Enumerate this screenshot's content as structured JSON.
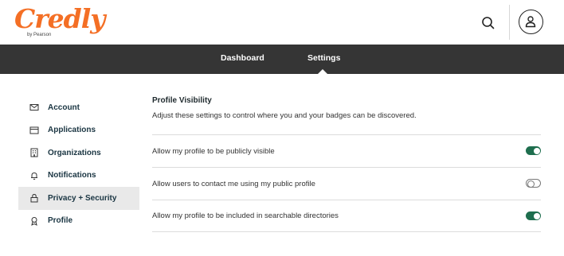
{
  "brand": {
    "name": "Credly",
    "sub": "by Pearson",
    "color": "#f46f25"
  },
  "header": {
    "search_icon": "search-icon",
    "avatar_icon": "user-icon"
  },
  "nav": {
    "tabs": [
      {
        "label": "Dashboard",
        "active": false
      },
      {
        "label": "Settings",
        "active": true
      }
    ],
    "background": "#353535"
  },
  "sidebar": {
    "items": [
      {
        "label": "Account",
        "icon": "mail-icon",
        "active": false
      },
      {
        "label": "Applications",
        "icon": "browser-window-icon",
        "active": false
      },
      {
        "label": "Organizations",
        "icon": "building-icon",
        "active": false
      },
      {
        "label": "Notifications",
        "icon": "bell-icon",
        "active": false
      },
      {
        "label": "Privacy + Security",
        "icon": "lock-icon",
        "active": true
      },
      {
        "label": "Profile",
        "icon": "badge-icon",
        "active": false
      }
    ]
  },
  "main": {
    "title": "Profile Visibility",
    "description": "Adjust these settings to control where you and your badges can be discovered.",
    "settings": [
      {
        "label": "Allow my profile to be publicly visible",
        "enabled": true
      },
      {
        "label": "Allow users to contact me using my public profile",
        "enabled": false
      },
      {
        "label": "Allow my profile to be included in searchable directories",
        "enabled": true
      }
    ],
    "toggle_on_color": "#1e6e4e"
  }
}
